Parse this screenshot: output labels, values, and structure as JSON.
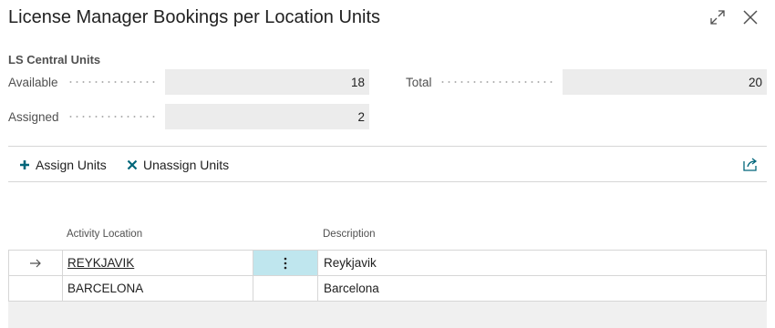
{
  "window": {
    "title": "License Manager Bookings per Location Units",
    "expand_icon": "expand-icon",
    "close_icon": "close-icon"
  },
  "summary": {
    "section_title": "LS Central Units",
    "available_label": "Available",
    "available_value": "18",
    "assigned_label": "Assigned",
    "assigned_value": "2",
    "total_label": "Total",
    "total_value": "20"
  },
  "actions": {
    "assign_label": "Assign Units",
    "unassign_label": "Unassign Units",
    "share_icon": "share-icon"
  },
  "table": {
    "columns": [
      "Activity Location",
      "Description"
    ],
    "rows": [
      {
        "location": "REYKJAVIK",
        "description": "Reykjavik",
        "selected": true
      },
      {
        "location": "BARCELONA",
        "description": "Barcelona",
        "selected": false
      }
    ]
  },
  "colors": {
    "accent": "#00667a",
    "selected_cell": "#bfe6ee",
    "field_background": "#ececec"
  }
}
